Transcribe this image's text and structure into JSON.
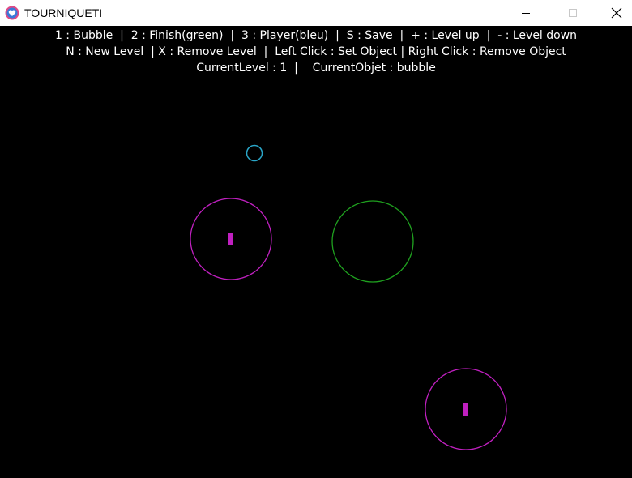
{
  "window": {
    "title": "TOURNIQUETI",
    "controls": [
      "minimize-icon",
      "maximize-icon",
      "close-icon"
    ]
  },
  "hud": {
    "line1": "1 : Bubble  |  2 : Finish(green)  |  3 : Player(bleu)  |  S : Save  |  + : Level up  |  - : Level down",
    "line2": "N : New Level  | X : Remove Level  |  Left Click : Set Object | Right Click : Remove Object",
    "line3": "CurrentLevel : 1  |    CurrentObjet : bubble"
  },
  "colors": {
    "background": "#000000",
    "bubble": "#c020c0",
    "finish": "#1fa01f",
    "player": "#2aa6c8",
    "hud_text": "#ffffff",
    "app_icon": "#e04a86"
  },
  "objects": {
    "player_type": "player",
    "finish_type": "finish",
    "bubble_type": "bubble"
  }
}
